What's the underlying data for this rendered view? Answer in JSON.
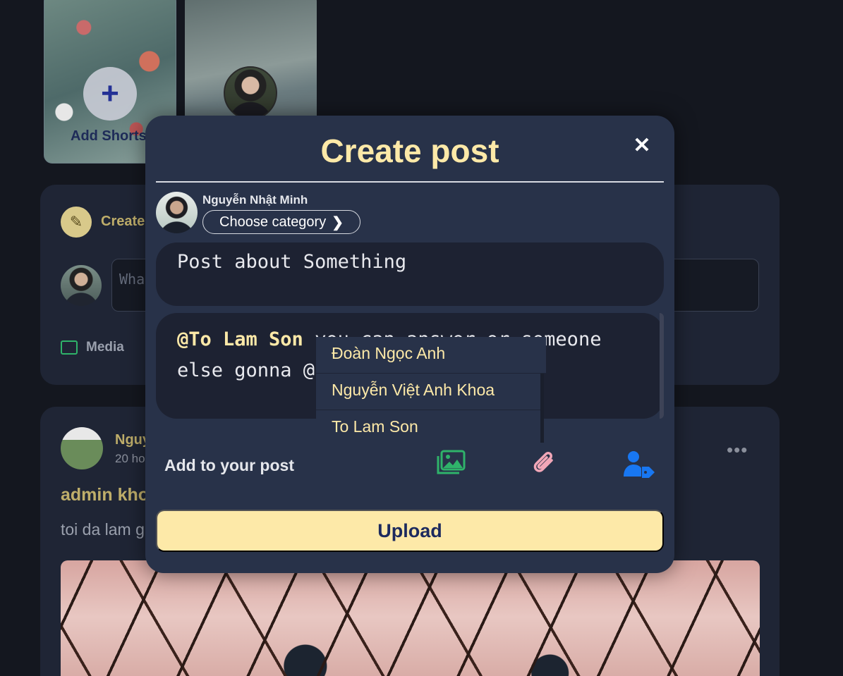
{
  "background": {
    "shorts": {
      "add_label": "Add Shorts",
      "add_icon": "+"
    },
    "composer": {
      "create_label": "Create",
      "input_placeholder": "Wha",
      "media_label": "Media"
    },
    "post": {
      "author": "Nguy",
      "time": "20 ho",
      "title": "admin kho",
      "text": "toi da lam g",
      "more_icon": "•••"
    }
  },
  "modal": {
    "title": "Create post",
    "close_icon": "✕",
    "user": {
      "name": "Nguyễn Nhật Minh",
      "category_button": "Choose category",
      "category_chevron": "❯"
    },
    "title_input": "Post about Something",
    "body": {
      "mention": "@To Lam Son",
      "text_line1": " you can answer or someone",
      "text_line2": "else gonna @"
    },
    "mention_suggestions": [
      "Đoàn Ngọc Anh",
      "Nguyễn Việt Anh Khoa",
      "To Lam Son"
    ],
    "add_to_post_label": "Add to your post",
    "icons": {
      "media": "media-icon",
      "attach": "paperclip-icon",
      "tag": "tag-user-icon"
    },
    "colors": {
      "accent": "#fde9a8",
      "media_icon": "#2fb36a",
      "attach_icon": "#f2a7b8",
      "tag_icon": "#1877f2"
    },
    "upload_button": "Upload"
  }
}
